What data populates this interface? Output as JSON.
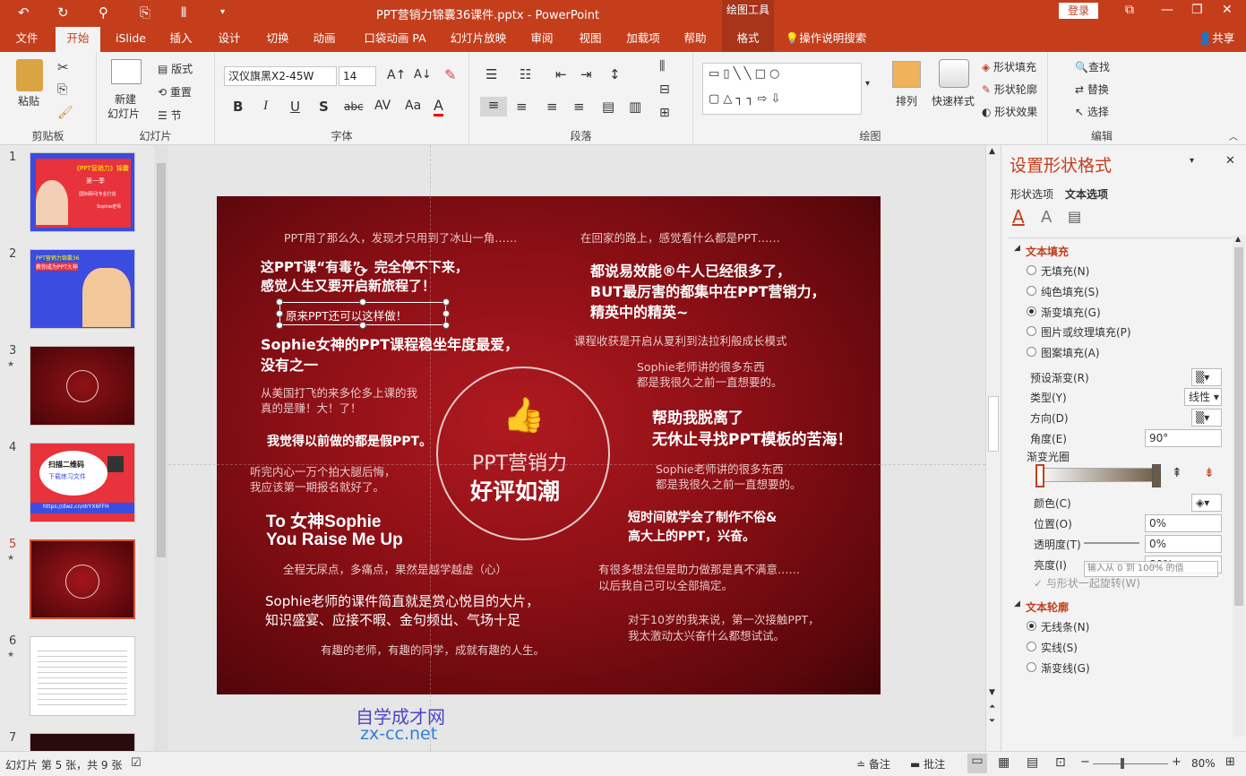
{
  "window": {
    "title": "PPT营销力锦囊36课件.pptx - PowerPoint",
    "context_tool": "绘图工具",
    "login": "登录"
  },
  "tabs": [
    "文件",
    "开始",
    "iSlide",
    "插入",
    "设计",
    "切换",
    "动画",
    "口袋动画 PA",
    "幻灯片放映",
    "审阅",
    "视图",
    "加载项",
    "帮助",
    "格式"
  ],
  "tell_me": "操作说明搜索",
  "share": "共享",
  "ribbon": {
    "clipboard": {
      "paste": "粘贴",
      "label": "剪贴板"
    },
    "slides": {
      "new_slide": "新建",
      "new_slide2": "幻灯片",
      "layout": "版式",
      "reset": "重置",
      "section": "节",
      "label": "幻灯片"
    },
    "font": {
      "name": "汉仪旗黑X2-45W",
      "size": "14",
      "label": "字体",
      "bold": "B",
      "italic": "I",
      "underline": "U",
      "shadow": "S",
      "strike": "abc",
      "spacing": "AV",
      "case": "Aa",
      "color": "A"
    },
    "paragraph": {
      "label": "段落"
    },
    "drawing": {
      "arrange": "排列",
      "quick_styles": "快速样式",
      "shape_fill": "形状填充",
      "shape_outline": "形状轮廓",
      "shape_effects": "形状效果",
      "label": "绘图"
    },
    "editing": {
      "find": "查找",
      "replace": "替换",
      "select": "选择",
      "label": "编辑"
    }
  },
  "thumbnails": [
    {
      "num": "1",
      "star": false,
      "texts": [
        "《PPT营销力》锦囊",
        "第一季",
        "国际顾问|专业打造",
        "Sophie老师"
      ]
    },
    {
      "num": "2",
      "star": false,
      "texts": [
        "PPT营销力锦囊36",
        "教你成为PPT大神"
      ]
    },
    {
      "num": "3",
      "star": true,
      "texts": []
    },
    {
      "num": "4",
      "star": false,
      "texts": [
        "扫描二维码",
        "下载练习文件",
        "https://dwz.cn/drYX6FFH"
      ]
    },
    {
      "num": "5",
      "star": true,
      "texts": []
    },
    {
      "num": "6",
      "star": true,
      "texts": []
    },
    {
      "num": "7",
      "star": false,
      "texts": []
    }
  ],
  "slide": {
    "center_title": "PPT营销力",
    "center_subtitle": "好评如潮",
    "quotes": [
      "PPT用了那么久，发现才只用到了冰山一角……",
      "在回家的路上，感觉看什么都是PPT……",
      "这PPT课“有毒”，完全停不下来，",
      "感觉人生又要开启新旅程了！",
      "都说易效能®牛人已经很多了，",
      "BUT最厉害的都集中在PPT营销力，",
      "精英中的精英~",
      "原来PPT还可以这样做！",
      "Sophie女神的PPT课程稳坐年度最爱，",
      "没有之一",
      "课程收获是开启从夏利到法拉利般成长模式",
      "Sophie老师讲的很多东西",
      "都是我很久之前一直想要的。",
      "从美国打飞的来多伦多上课的我",
      "真的是赚！大！了！",
      "帮助我脱离了",
      "无休止寻找PPT模板的苦海！",
      "我觉得以前做的都是假PPT。",
      "听完内心一万个拍大腿后悔，",
      "我应该第一期报名就好了。",
      "Sophie老师讲的很多东西",
      "都是我很久之前一直想要的。",
      "To 女神Sophie",
      "You Raise Me Up",
      "短时间就学会了制作不俗&",
      "高大上的PPT，兴奋。",
      "全程无尿点，多痛点，果然是越学越虚（心）",
      "有很多想法但是助力做那是真不满意……",
      "以后我自己可以全部搞定。",
      "Sophie老师的课件简直就是赏心悦目的大片，",
      "知识盛宴、应接不暇、金句频出、气场十足",
      "对于10岁的我来说，第一次接触PPT，",
      "我太激动太兴奋什么都想试试。",
      "有趣的老师，有趣的同学，成就有趣的人生。"
    ]
  },
  "watermark": {
    "line1": "自学成才网",
    "line2": "zx-cc.net"
  },
  "format_pane": {
    "title": "设置形状格式",
    "tab_shape": "形状选项",
    "tab_text": "文本选项",
    "section_fill": "文本填充",
    "fill_options": [
      "无填充(N)",
      "纯色填充(S)",
      "渐变填充(G)",
      "图片或纹理填充(P)",
      "图案填充(A)"
    ],
    "fill_selected": 2,
    "preset": "预设渐变(R)",
    "type_label": "类型(Y)",
    "type_value": "线性",
    "direction": "方向(D)",
    "angle_label": "角度(E)",
    "angle_value": "90°",
    "stops_label": "渐变光圈",
    "color_label": "颜色(C)",
    "position_label": "位置(O)",
    "position_value": "0%",
    "transparency_label": "透明度(T)",
    "transparency_value": "0%",
    "brightness_label": "亮度(I)",
    "brightness_value": "80%",
    "tooltip": "输入从 0 到 100% 的值",
    "rotate": "与形状一起旋转(W)",
    "section_outline": "文本轮廓",
    "outline_options": [
      "无线条(N)",
      "实线(S)",
      "渐变线(G)"
    ],
    "outline_selected": 0
  },
  "status": {
    "slide_info": "幻灯片 第 5 张，共 9 张",
    "notes": "备注",
    "comments": "批注",
    "zoom": "80%"
  }
}
